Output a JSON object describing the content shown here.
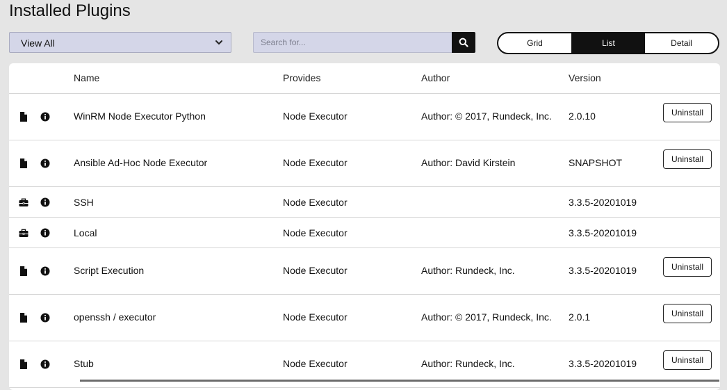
{
  "page": {
    "title": "Installed Plugins"
  },
  "filter": {
    "selected": "View All"
  },
  "search": {
    "placeholder": "Search for..."
  },
  "view_toggle": {
    "grid": "Grid",
    "list": "List",
    "detail": "Detail",
    "active": "List"
  },
  "table": {
    "headers": {
      "name": "Name",
      "provides": "Provides",
      "author": "Author",
      "version": "Version"
    },
    "rows": [
      {
        "icon": "file-icon",
        "name": "WinRM Node Executor Python",
        "provides": "Node Executor",
        "author": "Author: © 2017, Rundeck, Inc.",
        "version": "2.0.10",
        "action": "Uninstall"
      },
      {
        "icon": "file-icon",
        "name": "Ansible Ad-Hoc Node Executor",
        "provides": "Node Executor",
        "author": "Author: David Kirstein",
        "version": "SNAPSHOT",
        "action": "Uninstall"
      },
      {
        "icon": "briefcase-icon",
        "name": "SSH",
        "provides": "Node Executor",
        "author": "",
        "version": "3.3.5-20201019",
        "action": ""
      },
      {
        "icon": "briefcase-icon",
        "name": "Local",
        "provides": "Node Executor",
        "author": "",
        "version": "3.3.5-20201019",
        "action": ""
      },
      {
        "icon": "file-icon",
        "name": "Script Execution",
        "provides": "Node Executor",
        "author": "Author: Rundeck, Inc.",
        "version": "3.3.5-20201019",
        "action": "Uninstall"
      },
      {
        "icon": "file-icon",
        "name": "openssh / executor",
        "provides": "Node Executor",
        "author": "Author: © 2017, Rundeck, Inc.",
        "version": "2.0.1",
        "action": "Uninstall"
      },
      {
        "icon": "file-icon",
        "name": "Stub",
        "provides": "Node Executor",
        "author": "Author: Rundeck, Inc.",
        "version": "3.3.5-20201019",
        "action": "Uninstall"
      }
    ]
  },
  "colors": {
    "background": "#e5e5e5",
    "input_bg": "#d4d6e8",
    "active_toggle": "#111111"
  }
}
